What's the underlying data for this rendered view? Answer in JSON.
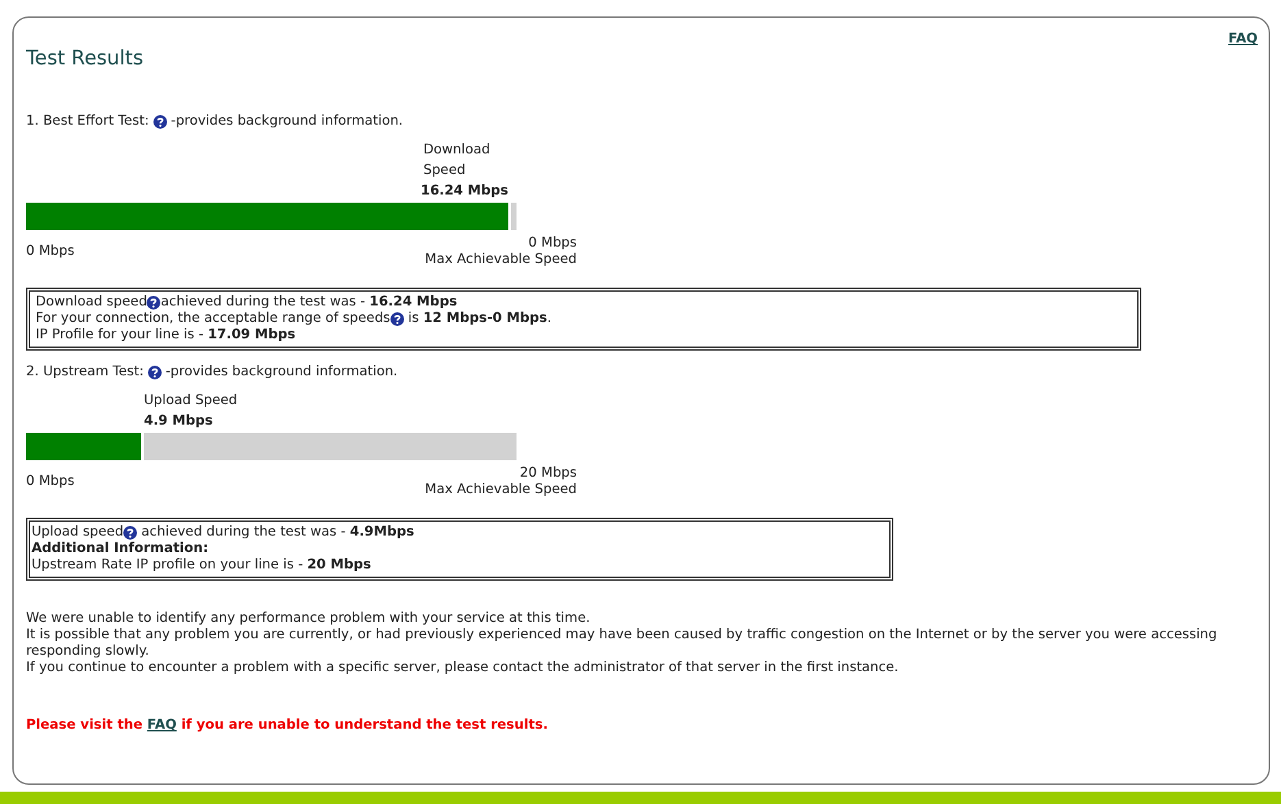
{
  "title": "Test Results",
  "faq_link": "FAQ",
  "tests": [
    {
      "heading": [
        {
          "kind": "text",
          "text": "1. Best Effort Test:"
        },
        {
          "kind": "help"
        },
        {
          "kind": "text",
          "text": "-provides background information."
        }
      ],
      "speed_label": "Download Speed",
      "speed_value": "16.24 Mbps",
      "level": 0.99,
      "min_label": "0 Mbps",
      "max_label": "0 Mbps",
      "max_caption": "Max Achievable Speed",
      "info": [
        [
          {
            "kind": "text",
            "text": "Download speed"
          },
          {
            "kind": "help"
          },
          {
            "kind": "text",
            "text": "achieved during the test was - **16.24 Mbps**"
          }
        ],
        [
          {
            "kind": "text",
            "text": "For your connection, the acceptable range of speeds"
          },
          {
            "kind": "help"
          },
          {
            "kind": "text",
            "text": " is **12 Mbps-0 Mbps**."
          }
        ],
        [
          {
            "kind": "text",
            "text": "IP Profile for your line is - **17.09 Mbps**"
          }
        ]
      ]
    },
    {
      "heading": [
        {
          "kind": "text",
          "text": "2. Upstream Test:"
        },
        {
          "kind": "help"
        },
        {
          "kind": "text",
          "text": "-provides background information."
        }
      ],
      "speed_label": "Upload Speed",
      "speed_value": "4.9 Mbps",
      "level": 0.24,
      "min_label": "0 Mbps",
      "max_label": "20 Mbps",
      "max_caption": "Max Achievable Speed",
      "info": [
        [
          {
            "kind": "text",
            "text": "Upload speed"
          },
          {
            "kind": "help"
          },
          {
            "kind": "text",
            "text": " achieved during the test was - **4.9Mbps**"
          }
        ],
        [
          {
            "kind": "bold",
            "text": "Additional Information:"
          }
        ],
        [
          {
            "kind": "text",
            "text": "Upstream Rate IP profile on your line is - **20 Mbps**"
          }
        ]
      ]
    }
  ],
  "messages": [
    "We were unable to identify any performance problem with your service at this time.",
    "It is possible that any problem you are currently, or had previously experienced may have been caused by traffic congestion on the Internet or by the server you were accessing responding slowly.",
    "If you continue to encounter a problem with a specific server, please contact the administrator of that server in the first instance."
  ],
  "notice": {
    "before": "Please visit the ",
    "link": "FAQ",
    "after": " if you are unable to understand the test results."
  }
}
